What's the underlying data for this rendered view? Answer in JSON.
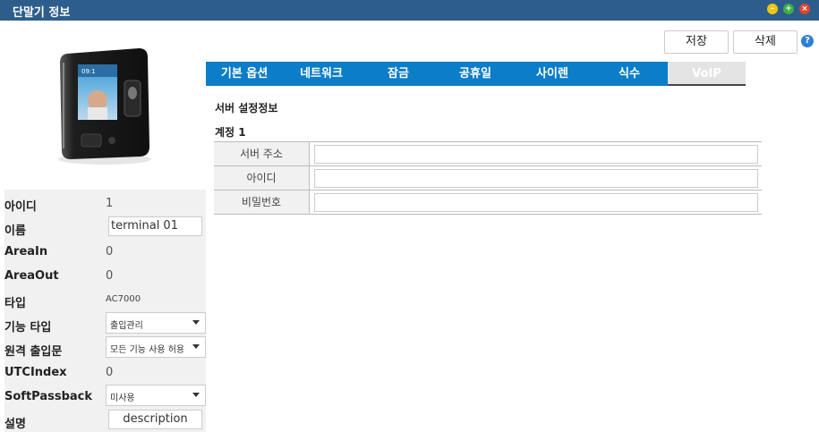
{
  "window": {
    "title": "단말기 정보",
    "controls": [
      "minimize-icon",
      "maximize-icon",
      "close-icon"
    ],
    "title_bar_color": "#2d5d8b"
  },
  "device": {
    "fields": {
      "id": {
        "label": "아이디",
        "value": "1"
      },
      "name": {
        "label": "이름",
        "value": "terminal 01"
      },
      "area_in": {
        "label": "AreaIn",
        "value": "0"
      },
      "area_out": {
        "label": "AreaOut",
        "value": "0"
      },
      "type": {
        "label": "타입",
        "value": "AC7000"
      },
      "function_type": {
        "label": "기능 타입",
        "value": "출입관리"
      },
      "remote_door": {
        "label": "원격 출입문",
        "value": "모든 기능 사용 허용"
      },
      "utc_index": {
        "label": "UTCIndex",
        "value": "0"
      },
      "soft_passback": {
        "label": "SoftPassback",
        "value": "미사용"
      },
      "description": {
        "label": "설명",
        "value": "description"
      }
    }
  },
  "toolbar": {
    "save_label": "저장",
    "delete_label": "삭제",
    "help_label": "?"
  },
  "tabs": [
    {
      "label": "기본 옵션",
      "active": false
    },
    {
      "label": "네트워크",
      "active": false
    },
    {
      "label": "잠금",
      "active": false
    },
    {
      "label": "공휴일",
      "active": false
    },
    {
      "label": "사이렌",
      "active": false
    },
    {
      "label": "식수",
      "active": false
    },
    {
      "label": "VoIP",
      "active": true
    }
  ],
  "tab_color": "#0c7dc8",
  "voip": {
    "section_title": "서버 설정정보",
    "account_title": "계정 1",
    "rows": [
      {
        "label": "서버 주소",
        "value": ""
      },
      {
        "label": "아이디",
        "value": ""
      },
      {
        "label": "비밀번호",
        "value": ""
      }
    ]
  }
}
